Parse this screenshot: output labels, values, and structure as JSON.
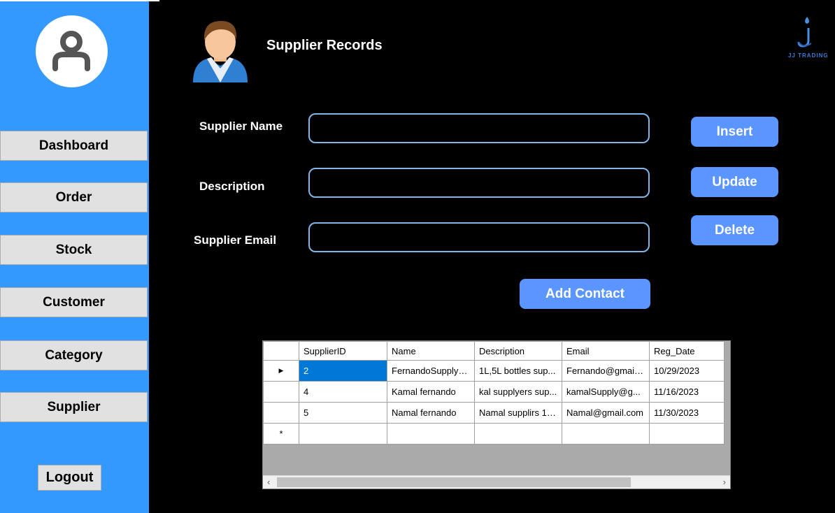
{
  "sidebar": {
    "nav": [
      {
        "label": "Dashboard"
      },
      {
        "label": "Order"
      },
      {
        "label": "Stock"
      },
      {
        "label": "Customer"
      },
      {
        "label": "Category"
      },
      {
        "label": "Supplier"
      }
    ],
    "logout_label": "Logout"
  },
  "header": {
    "title": "Supplier Records",
    "brand": "JJ TRADING"
  },
  "form": {
    "supplier_name_label": "Supplier Name",
    "description_label": "Description",
    "supplier_email_label": "Supplier Email",
    "supplier_name_value": "",
    "description_value": "",
    "supplier_email_value": ""
  },
  "buttons": {
    "insert": "Insert",
    "update": "Update",
    "delete": "Delete",
    "add_contact": "Add Contact"
  },
  "grid": {
    "columns": [
      "SupplierID",
      "Name",
      "Description",
      "Email",
      "Reg_Date"
    ],
    "rows": [
      [
        "2",
        "FernandoSupplyers",
        "1L,5L bottles sup...",
        "Fernando@gmail....",
        "10/29/2023"
      ],
      [
        "4",
        "Kamal fernando",
        "kal supplyers sup...",
        "kamalSupply@g...",
        "11/16/2023"
      ],
      [
        "5",
        "Namal fernando",
        "Namal supplirs 1L...",
        "Namal@gmail.com",
        "11/30/2023"
      ]
    ],
    "current_row_marker": "▶",
    "new_row_marker": "*"
  },
  "colors": {
    "sidebar": "#3399ff",
    "accent_button": "#5b95ff",
    "input_border": "#7fb8e8"
  },
  "icons": [
    "user-avatar-icon",
    "person-icon",
    "brand-logo-icon"
  ]
}
